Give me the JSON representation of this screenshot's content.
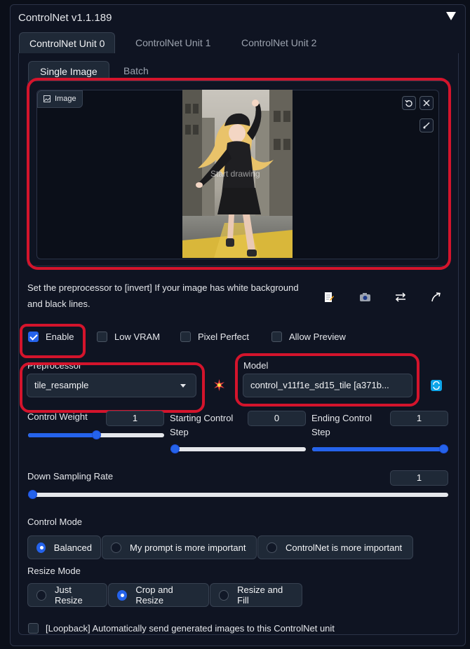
{
  "header": {
    "title": "ControlNet v1.1.189"
  },
  "unit_tabs": [
    "ControlNet Unit 0",
    "ControlNet Unit 1",
    "ControlNet Unit 2"
  ],
  "image_tabs": [
    "Single Image",
    "Batch"
  ],
  "image_panel": {
    "label": "Image",
    "start_drawing": "Start drawing"
  },
  "hint": "Set the preprocessor to [invert] If your image has white background and black lines.",
  "checkboxes": [
    {
      "label": "Enable",
      "checked": true
    },
    {
      "label": "Low VRAM",
      "checked": false
    },
    {
      "label": "Pixel Perfect",
      "checked": false
    },
    {
      "label": "Allow Preview",
      "checked": false
    }
  ],
  "preprocessor": {
    "label": "Preprocessor",
    "value": "tile_resample"
  },
  "model": {
    "label": "Model",
    "value": "control_v11f1e_sd15_tile [a371b..."
  },
  "sliders": {
    "control_weight": {
      "label": "Control Weight",
      "value": "1",
      "fraction": 0.5
    },
    "starting_step": {
      "label": "Starting Control Step",
      "value": "0",
      "fraction": 0.0
    },
    "ending_step": {
      "label": "Ending Control Step",
      "value": "1",
      "fraction": 1.0
    },
    "down_sampling": {
      "label": "Down Sampling Rate",
      "value": "1",
      "fraction": 0.0
    }
  },
  "control_mode": {
    "label": "Control Mode",
    "options": [
      "Balanced",
      "My prompt is more important",
      "ControlNet is more important"
    ],
    "selected": "Balanced"
  },
  "resize_mode": {
    "label": "Resize Mode",
    "options": [
      "Just Resize",
      "Crop and Resize",
      "Resize and Fill"
    ],
    "selected": "Crop and Resize"
  },
  "loopback": {
    "label": "[Loopback] Automatically send generated images to this ControlNet unit",
    "checked": false
  },
  "colors": {
    "accent": "#2563eb",
    "annotation_red": "#d4142c",
    "background": "#0b0f19"
  }
}
